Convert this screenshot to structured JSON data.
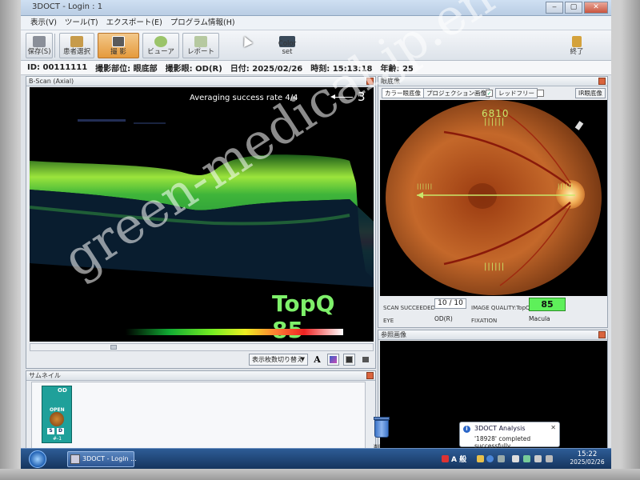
{
  "window": {
    "title": "3DOCT - Login : 1",
    "controls": {
      "minimize": "‒",
      "maximize": "▢",
      "close": "✕"
    }
  },
  "menu": [
    "表示(V)",
    "ツール(T)",
    "エクスポート(E)",
    "プログラム情報(H)"
  ],
  "toolbar": {
    "save": "保存(S)",
    "patient_select": "患者選択",
    "capture": "撮 影",
    "viewer": "ビューア",
    "report": "レポート",
    "color_set": "Color set",
    "exit": "終了"
  },
  "info": {
    "id": "ID: 00111111",
    "part": "撮影部位: 眼底部",
    "eye": "撮影眼: OD(R)",
    "date": "日付: 2025/02/26",
    "time": "時刻: 15:13:18",
    "age": "年齢: 25"
  },
  "bscan": {
    "title": "B-Scan (Axial)",
    "averaging": "Averaging success rate  4/4",
    "annotation": "3",
    "topq_label": "TopQ 85",
    "switch_button": "表示枚数切り替え",
    "tool_a": "A"
  },
  "fundus": {
    "title": "眼底像",
    "tabs": [
      "カラー眼底像",
      "プロジェクション画像",
      "レッドフリー",
      "IR眼底像"
    ],
    "number_overlay": "6810",
    "tick_marks": "||||||",
    "labels": {
      "scan_succeeded": "SCAN SUCCEEDED",
      "eye": "EYE",
      "image_quality": "IMAGE QUALITY:TopQ",
      "fixation": "FIXATION"
    },
    "values": {
      "scan_count": "10 / 10",
      "eye": "OD(R)",
      "topq": "85",
      "fixation": "Macula"
    }
  },
  "reference": {
    "title": "参照画像"
  },
  "thumbnails": {
    "title": "サムネイル",
    "card": {
      "eye": "OD",
      "status": "OPEN",
      "s_tag": "S",
      "d_tag": "D",
      "index": "#-1"
    },
    "trash_label": "削除"
  },
  "notification": {
    "title": "3DOCT Analysis",
    "message": "'18928' completed successfully",
    "icon": "i",
    "close": "✕"
  },
  "taskbar": {
    "app_item": "3DOCT - Login ...",
    "ime": "A 般",
    "time": "15:22",
    "date": "2025/02/26"
  },
  "watermark": "green-medical.jp.en",
  "colors": {
    "topq_text": "#7ef06a",
    "topq_box": "#5ef05a",
    "overlay_lines": "#c9e86b",
    "active_tool": "#e59a3c"
  }
}
